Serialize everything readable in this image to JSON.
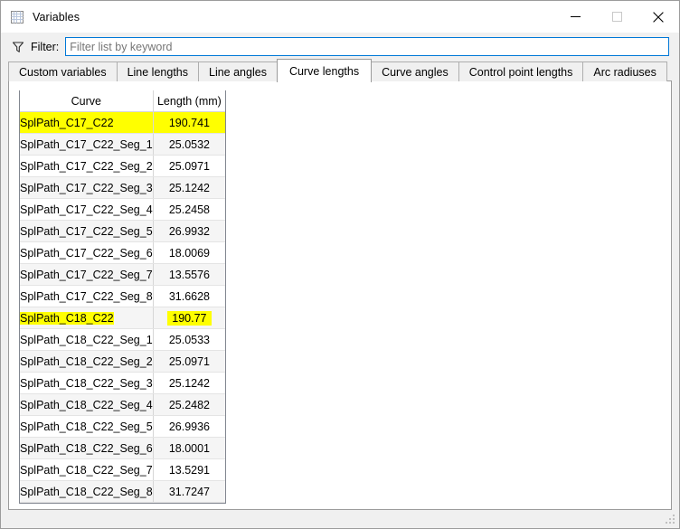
{
  "window": {
    "title": "Variables",
    "icon": "table-grid-icon",
    "controls": {
      "minimize": "minimize-icon",
      "maximize": "maximize-icon",
      "close": "close-icon"
    }
  },
  "filter": {
    "icon": "funnel-icon",
    "label": "Filter:",
    "value": "",
    "placeholder": "Filter list by keyword"
  },
  "tabs": [
    {
      "label": "Custom variables",
      "active": false
    },
    {
      "label": "Line lengths",
      "active": false
    },
    {
      "label": "Line angles",
      "active": false
    },
    {
      "label": "Curve lengths",
      "active": true
    },
    {
      "label": "Curve angles",
      "active": false
    },
    {
      "label": "Control point lengths",
      "active": false
    },
    {
      "label": "Arc radiuses",
      "active": false
    }
  ],
  "table": {
    "columns": [
      "Curve",
      "Length (mm)"
    ],
    "rows": [
      {
        "name": "SplPath_C17_C22",
        "value": "190.741",
        "highlight": "full"
      },
      {
        "name": "SplPath_C17_C22_Seg_1",
        "value": "25.0532",
        "highlight": "none"
      },
      {
        "name": "SplPath_C17_C22_Seg_2",
        "value": "25.0971",
        "highlight": "none"
      },
      {
        "name": "SplPath_C17_C22_Seg_3",
        "value": "25.1242",
        "highlight": "none"
      },
      {
        "name": "SplPath_C17_C22_Seg_4",
        "value": "25.2458",
        "highlight": "none"
      },
      {
        "name": "SplPath_C17_C22_Seg_5",
        "value": "26.9932",
        "highlight": "none"
      },
      {
        "name": "SplPath_C17_C22_Seg_6",
        "value": "18.0069",
        "highlight": "none"
      },
      {
        "name": "SplPath_C17_C22_Seg_7",
        "value": "13.5576",
        "highlight": "none"
      },
      {
        "name": "SplPath_C17_C22_Seg_8",
        "value": "31.6628",
        "highlight": "none"
      },
      {
        "name": "SplPath_C18_C22",
        "value": "190.77",
        "highlight": "text"
      },
      {
        "name": "SplPath_C18_C22_Seg_1",
        "value": "25.0533",
        "highlight": "none"
      },
      {
        "name": "SplPath_C18_C22_Seg_2",
        "value": "25.0971",
        "highlight": "none"
      },
      {
        "name": "SplPath_C18_C22_Seg_3",
        "value": "25.1242",
        "highlight": "none"
      },
      {
        "name": "SplPath_C18_C22_Seg_4",
        "value": "25.2482",
        "highlight": "none"
      },
      {
        "name": "SplPath_C18_C22_Seg_5",
        "value": "26.9936",
        "highlight": "none"
      },
      {
        "name": "SplPath_C18_C22_Seg_6",
        "value": "18.0001",
        "highlight": "none"
      },
      {
        "name": "SplPath_C18_C22_Seg_7",
        "value": "13.5291",
        "highlight": "none"
      },
      {
        "name": "SplPath_C18_C22_Seg_8",
        "value": "31.7247",
        "highlight": "none"
      }
    ]
  },
  "colors": {
    "highlight": "#ffff00",
    "focus_border": "#0078d7",
    "chrome": "#f0f0f0"
  }
}
